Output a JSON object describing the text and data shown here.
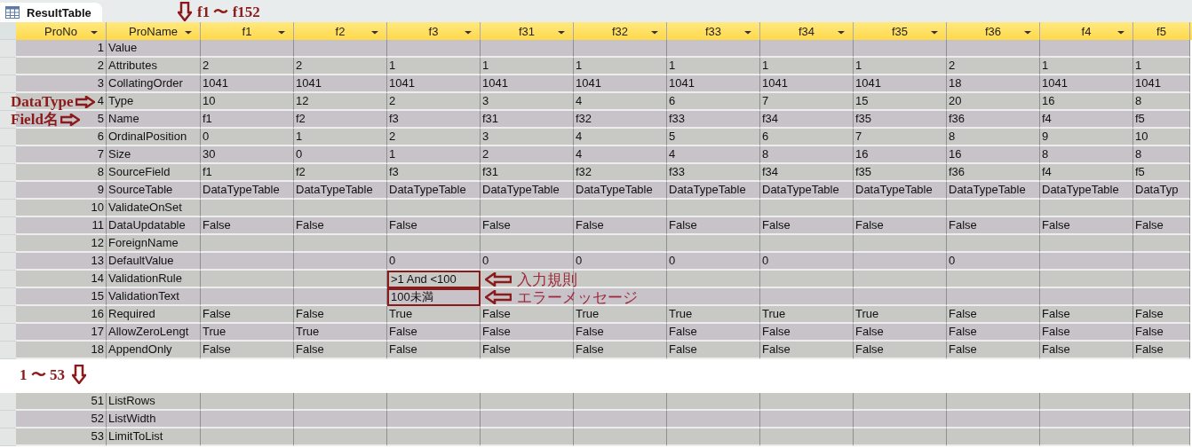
{
  "tab": {
    "title": "ResultTable"
  },
  "columns_note": "f1 〜 f152",
  "columns": [
    {
      "label": "ProNo",
      "dropdown": true
    },
    {
      "label": "ProName",
      "dropdown": true
    },
    {
      "label": "f1",
      "dropdown": true
    },
    {
      "label": "f2",
      "dropdown": true
    },
    {
      "label": "f3",
      "dropdown": true
    },
    {
      "label": "f31",
      "dropdown": true
    },
    {
      "label": "f32",
      "dropdown": true
    },
    {
      "label": "f33",
      "dropdown": true
    },
    {
      "label": "f34",
      "dropdown": true
    },
    {
      "label": "f35",
      "dropdown": true
    },
    {
      "label": "f36",
      "dropdown": true
    },
    {
      "label": "f4",
      "dropdown": true
    },
    {
      "label": "f5",
      "dropdown": false
    }
  ],
  "rows": [
    {
      "no": "1",
      "name": "Value"
    },
    {
      "no": "2",
      "name": "Attributes",
      "values": [
        "2",
        "2",
        "1",
        "1",
        "1",
        "1",
        "1",
        "1",
        "2",
        "1",
        "1"
      ]
    },
    {
      "no": "3",
      "name": "CollatingOrder",
      "values": [
        "1041",
        "1041",
        "1041",
        "1041",
        "1041",
        "1041",
        "1041",
        "1041",
        "18",
        "1041",
        "1041"
      ]
    },
    {
      "no": "4",
      "name": "Type",
      "note": "DataType",
      "values": [
        "10",
        "12",
        "2",
        "3",
        "4",
        "6",
        "7",
        "15",
        "20",
        "16",
        "8"
      ]
    },
    {
      "no": "5",
      "name": "Name",
      "note": "Field名",
      "values": [
        "f1",
        "f2",
        "f3",
        "f31",
        "f32",
        "f33",
        "f34",
        "f35",
        "f36",
        "f4",
        "f5"
      ]
    },
    {
      "no": "6",
      "name": "OrdinalPosition",
      "values": [
        "0",
        "1",
        "2",
        "3",
        "4",
        "5",
        "6",
        "7",
        "8",
        "9",
        "10"
      ]
    },
    {
      "no": "7",
      "name": "Size",
      "values": [
        "30",
        "0",
        "1",
        "2",
        "4",
        "4",
        "8",
        "16",
        "16",
        "8",
        "8"
      ]
    },
    {
      "no": "8",
      "name": "SourceField",
      "values": [
        "f1",
        "f2",
        "f3",
        "f31",
        "f32",
        "f33",
        "f34",
        "f35",
        "f36",
        "f4",
        "f5"
      ]
    },
    {
      "no": "9",
      "name": "SourceTable",
      "values": [
        "DataTypeTable",
        "DataTypeTable",
        "DataTypeTable",
        "DataTypeTable",
        "DataTypeTable",
        "DataTypeTable",
        "DataTypeTable",
        "DataTypeTable",
        "DataTypeTable",
        "DataTypeTable",
        "DataTyp"
      ]
    },
    {
      "no": "10",
      "name": "ValidateOnSet"
    },
    {
      "no": "11",
      "name": "DataUpdatable",
      "values": [
        "False",
        "False",
        "False",
        "False",
        "False",
        "False",
        "False",
        "False",
        "False",
        "False",
        "False"
      ]
    },
    {
      "no": "12",
      "name": "ForeignName"
    },
    {
      "no": "13",
      "name": "DefaultValue",
      "values": [
        {
          "blank": true
        },
        {
          "blank": true
        },
        "0",
        "0",
        "0",
        "0",
        "0",
        {
          "blank": true
        },
        "0",
        {
          "blank": true
        },
        {
          "blank": true
        }
      ]
    },
    {
      "no": "14",
      "name": "ValidationRule",
      "values": [
        {
          "blank": true
        },
        {
          "blank": true
        },
        {
          "text": ">1 And <100",
          "callout": "入力規則"
        },
        {
          "blank": true
        },
        {
          "blank": true
        },
        {
          "blank": true
        },
        {
          "blank": true
        },
        {
          "blank": true
        },
        {
          "blank": true
        },
        {
          "blank": true
        },
        {
          "blank": true
        }
      ]
    },
    {
      "no": "15",
      "name": "ValidationText",
      "values": [
        {
          "blank": true
        },
        {
          "blank": true
        },
        {
          "text": "100未満",
          "callout": "エラーメッセージ"
        },
        {
          "blank": true
        },
        {
          "blank": true
        },
        {
          "blank": true
        },
        {
          "blank": true
        },
        {
          "blank": true
        },
        {
          "blank": true
        },
        {
          "blank": true
        },
        {
          "blank": true
        }
      ]
    },
    {
      "no": "16",
      "name": "Required",
      "values": [
        "False",
        "False",
        "True",
        "False",
        "True",
        "True",
        "True",
        "True",
        "False",
        "False",
        "False"
      ]
    },
    {
      "no": "17",
      "name": "AllowZeroLengt",
      "values": [
        "True",
        "True",
        "False",
        "False",
        "False",
        "False",
        "False",
        "False",
        "False",
        "False",
        "False"
      ]
    },
    {
      "no": "18",
      "name": "AppendOnly",
      "values": [
        "False",
        "False",
        "False",
        "False",
        "False",
        "False",
        "False",
        "False",
        "False",
        "False",
        "False"
      ]
    }
  ],
  "rows_note": "1 〜 53",
  "more_rows": [
    {
      "no": "51",
      "name": "ListRows"
    },
    {
      "no": "52",
      "name": "ListWidth"
    },
    {
      "no": "53",
      "name": "LimitToList"
    }
  ]
}
